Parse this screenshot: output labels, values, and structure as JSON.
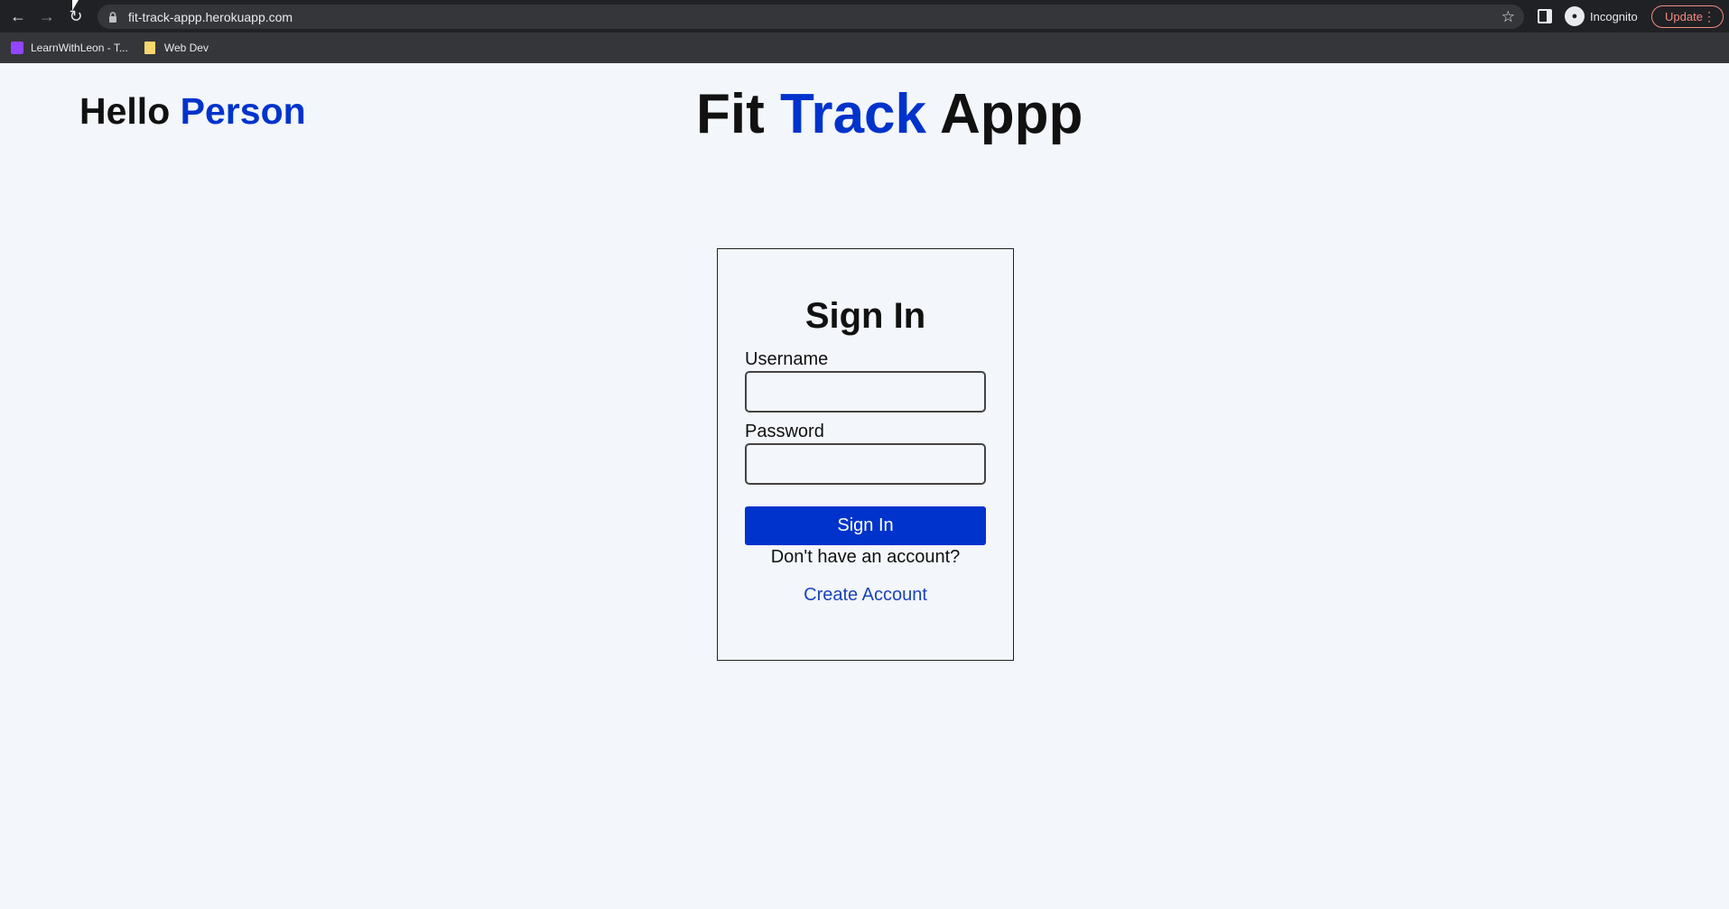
{
  "browser": {
    "url": "fit-track-appp.herokuapp.com",
    "incognito_label": "Incognito",
    "update_label": "Update",
    "bookmarks": [
      {
        "label": "LearnWithLeon - T..."
      },
      {
        "label": "Web Dev"
      }
    ]
  },
  "header": {
    "greeting_word": "Hello",
    "greeting_name": "Person",
    "title_part1": "Fit",
    "title_part2": "Track",
    "title_part3": "Appp"
  },
  "signin": {
    "heading": "Sign In",
    "username_label": "Username",
    "username_value": "",
    "password_label": "Password",
    "password_value": "",
    "submit_label": "Sign In",
    "no_account_text": "Don't have an account?",
    "create_account_label": "Create Account"
  },
  "colors": {
    "accent": "#0033cc",
    "link": "#1a44b8",
    "page_bg": "#f3f6fa"
  }
}
